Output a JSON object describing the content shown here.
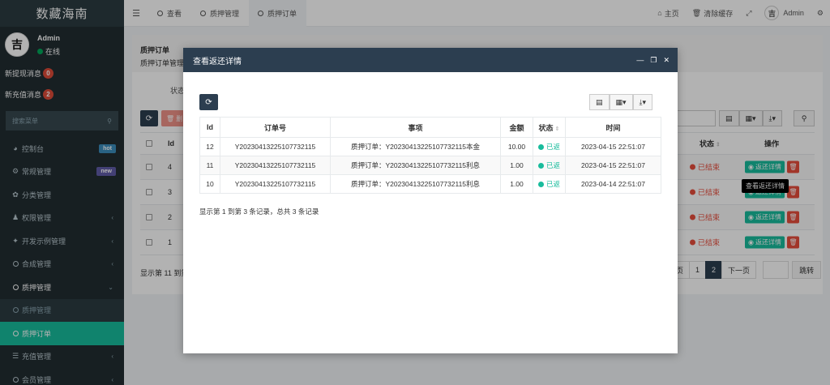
{
  "sidebar": {
    "logo": "数藏海南",
    "user_name": "Admin",
    "user_status": "在线",
    "messages": [
      {
        "label": "新提现消息",
        "count": "0"
      },
      {
        "label": "新充值消息",
        "count": "2"
      }
    ],
    "search_placeholder": "搜索菜单",
    "menu": [
      {
        "label": "控制台",
        "icon": "dashboard-icon",
        "tag": "hot"
      },
      {
        "label": "常规管理",
        "icon": "cogs-icon",
        "tag": "new"
      },
      {
        "label": "分类管理",
        "icon": "leaf-icon"
      },
      {
        "label": "权限管理",
        "icon": "group-icon",
        "arrow": true
      },
      {
        "label": "开发示例管理",
        "icon": "magic-icon",
        "arrow": true
      },
      {
        "label": "合成管理",
        "icon": "circle-icon",
        "arrow": true
      },
      {
        "label": "质押管理",
        "icon": "circle-icon",
        "arrow": true,
        "open": true
      },
      {
        "label": "质押管理",
        "icon": "circle-icon",
        "sub": true
      },
      {
        "label": "质押订单",
        "icon": "circle-icon",
        "active": true
      },
      {
        "label": "充值管理",
        "icon": "list-icon",
        "arrow": true
      },
      {
        "label": "会员管理",
        "icon": "circle-icon",
        "arrow": true
      }
    ]
  },
  "topbar": {
    "tabs": [
      "查看",
      "质押管理",
      "质押订单"
    ],
    "home": "主页",
    "clear_cache": "清除缓存",
    "admin": "Admin"
  },
  "background": {
    "title": "质押订单",
    "subtitle": "质押订单管理",
    "filter_label": "状态",
    "delete_label": "删",
    "table_headers": {
      "id": "Id",
      "status": "状态",
      "operate": "操作"
    },
    "rows": [
      {
        "id": "4",
        "status": "已结束"
      },
      {
        "id": "3",
        "status": "已结束"
      },
      {
        "id": "2",
        "status": "已结束"
      },
      {
        "id": "1",
        "status": "已结束"
      }
    ],
    "detail_button": "返还详情",
    "tooltip": "查看返还详情",
    "footer": "显示第 11 到第",
    "pager": [
      "页",
      "1",
      "2",
      "下一页"
    ],
    "jump": "跳转"
  },
  "modal": {
    "title": "查看返还详情",
    "headers": [
      "Id",
      "订单号",
      "事项",
      "金额",
      "状态",
      "时间"
    ],
    "rows": [
      {
        "id": "12",
        "order": "Y20230413225107732115",
        "item": "质押订单：Y20230413225107732115本金",
        "amount": "10.00",
        "status": "已返",
        "time": "2023-04-15 22:51:07"
      },
      {
        "id": "11",
        "order": "Y20230413225107732115",
        "item": "质押订单：Y20230413225107732115利息",
        "amount": "1.00",
        "status": "已返",
        "time": "2023-04-15 22:51:07"
      },
      {
        "id": "10",
        "order": "Y20230413225107732115",
        "item": "质押订单：Y20230413225107732115利息",
        "amount": "1.00",
        "status": "已返",
        "time": "2023-04-14 22:51:07"
      }
    ],
    "footer": "显示第 1 到第 3 条记录，总共 3 条记录"
  }
}
